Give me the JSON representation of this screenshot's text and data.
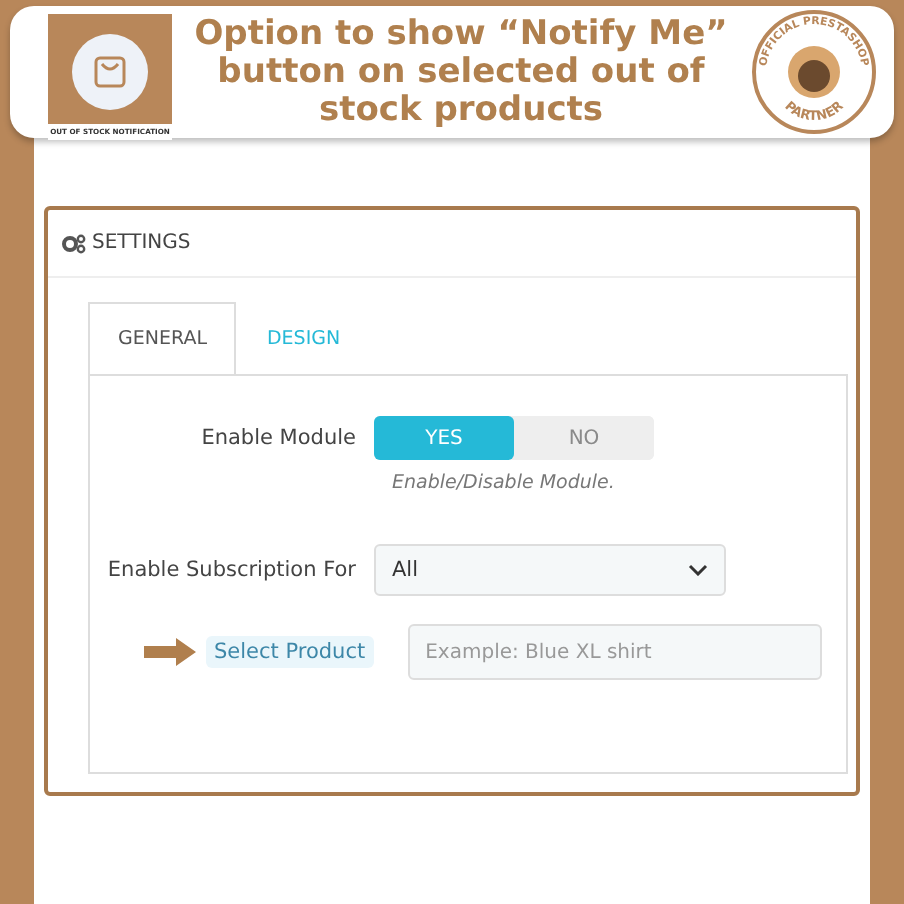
{
  "header": {
    "title": "Option to show “Notify Me” button on selected out of stock products",
    "logo_caption": "OUT OF STOCK NOTIFICATION",
    "badge_top": "OFFICIAL PRESTASHOP",
    "badge_bottom": "PARTNER"
  },
  "panel": {
    "title": "SETTINGS"
  },
  "tabs": [
    {
      "label": "GENERAL",
      "selected": true
    },
    {
      "label": "DESIGN",
      "selected": false
    }
  ],
  "enable_module": {
    "label": "Enable Module",
    "options": [
      {
        "label": "YES",
        "selected": true
      },
      {
        "label": "NO",
        "selected": false
      }
    ],
    "help": "Enable/Disable Module."
  },
  "subscription": {
    "label": "Enable Subscription For",
    "value": "All"
  },
  "product": {
    "label": "Select Product",
    "placeholder": "Example: Blue XL shirt"
  }
}
